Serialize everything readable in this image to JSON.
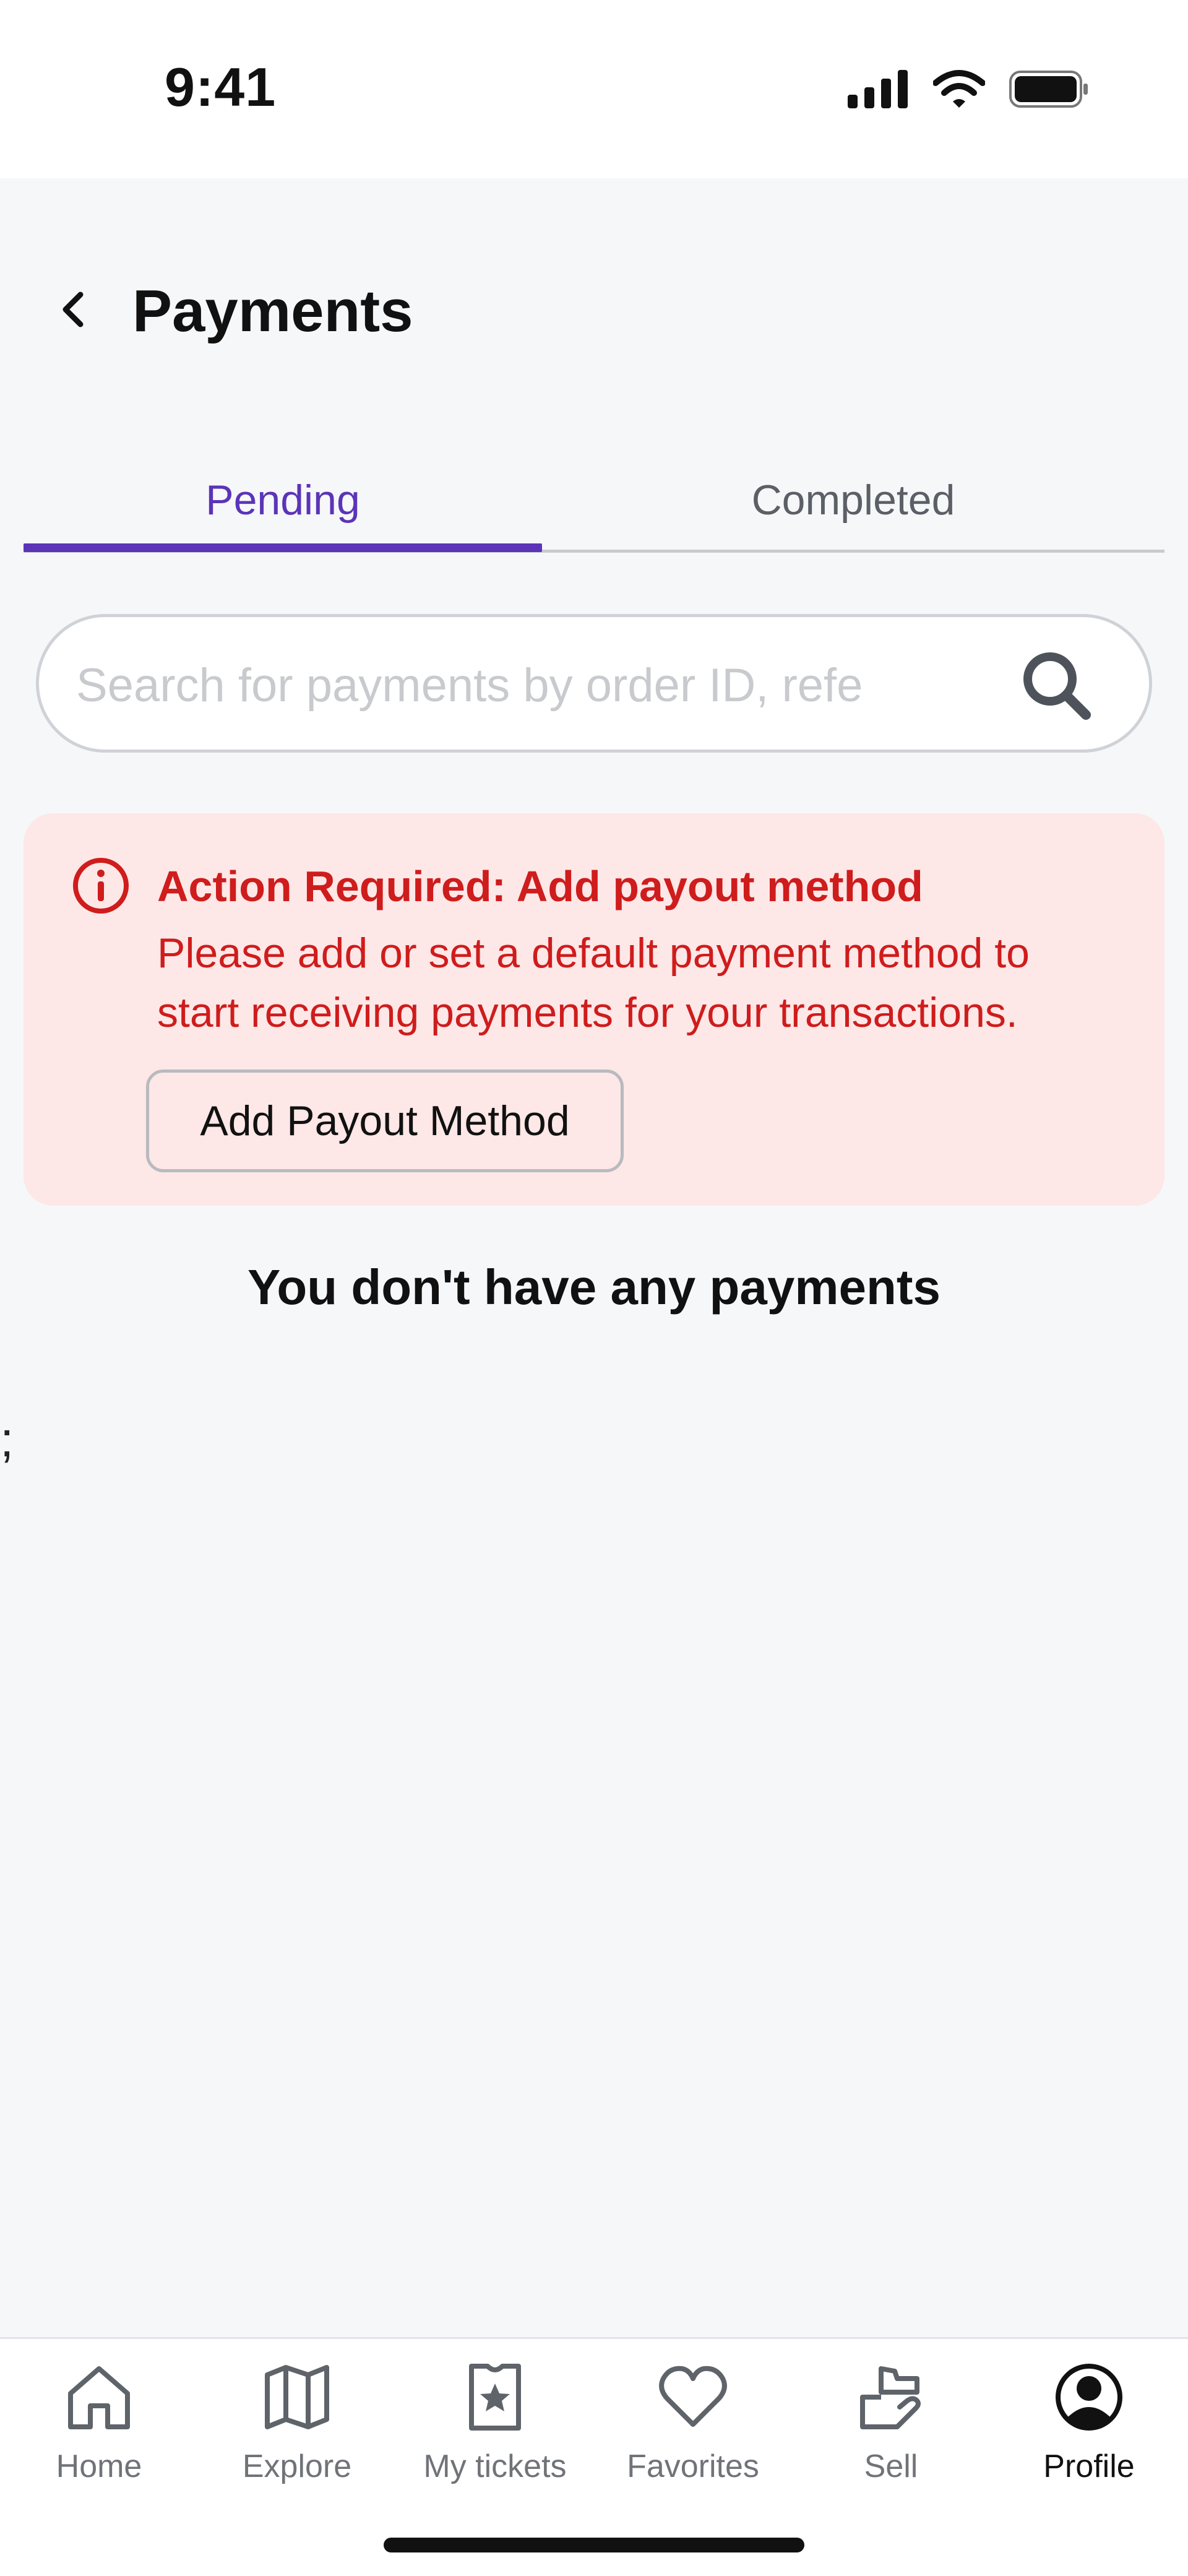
{
  "status_bar": {
    "time": "9:41"
  },
  "header": {
    "title": "Payments"
  },
  "tabs": [
    {
      "label": "Pending",
      "active": true
    },
    {
      "label": "Completed",
      "active": false
    }
  ],
  "search": {
    "placeholder": "Search for payments by order ID, refe"
  },
  "alert": {
    "title": "Action Required: Add payout method",
    "message": "Please add or set a default payment method to start receiving payments for your transactions.",
    "button_label": "Add Payout Method"
  },
  "empty_state": {
    "message": "You don't have any payments"
  },
  "stray_text": ";",
  "bottom_nav": [
    {
      "label": "Home",
      "icon": "home-icon"
    },
    {
      "label": "Explore",
      "icon": "map-icon"
    },
    {
      "label": "My tickets",
      "icon": "ticket-icon"
    },
    {
      "label": "Favorites",
      "icon": "heart-icon"
    },
    {
      "label": "Sell",
      "icon": "sell-icon"
    },
    {
      "label": "Profile",
      "icon": "profile-icon",
      "active": true
    }
  ],
  "colors": {
    "accent": "#5b34b8",
    "alert_text": "#cf1c1c",
    "alert_background": "#fde7e7",
    "page_background": "#f6f7f9"
  }
}
